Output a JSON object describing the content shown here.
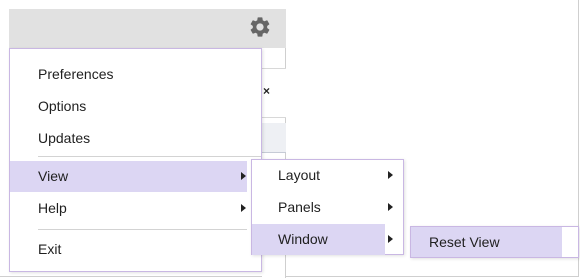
{
  "toolbar": {
    "settings_icon": "gear-icon"
  },
  "background_panel": {
    "close_glyph": "×"
  },
  "main_menu": {
    "items": [
      {
        "label": "Preferences"
      },
      {
        "label": "Options"
      },
      {
        "label": "Updates"
      },
      {
        "label": "View",
        "has_submenu": true,
        "highlighted": true
      },
      {
        "label": "Help",
        "has_submenu": true
      },
      {
        "label": "Exit"
      }
    ]
  },
  "view_submenu": {
    "items": [
      {
        "label": "Layout",
        "has_submenu": true
      },
      {
        "label": "Panels",
        "has_submenu": true
      },
      {
        "label": "Window",
        "has_submenu": true,
        "highlighted": true
      }
    ]
  },
  "window_submenu": {
    "items": [
      {
        "label": "Reset View",
        "highlighted": true
      }
    ]
  },
  "colors": {
    "highlight": "#dcd6f3",
    "menu_border": "#c9b7e3",
    "toolbar_bg": "#e1e1e1"
  }
}
